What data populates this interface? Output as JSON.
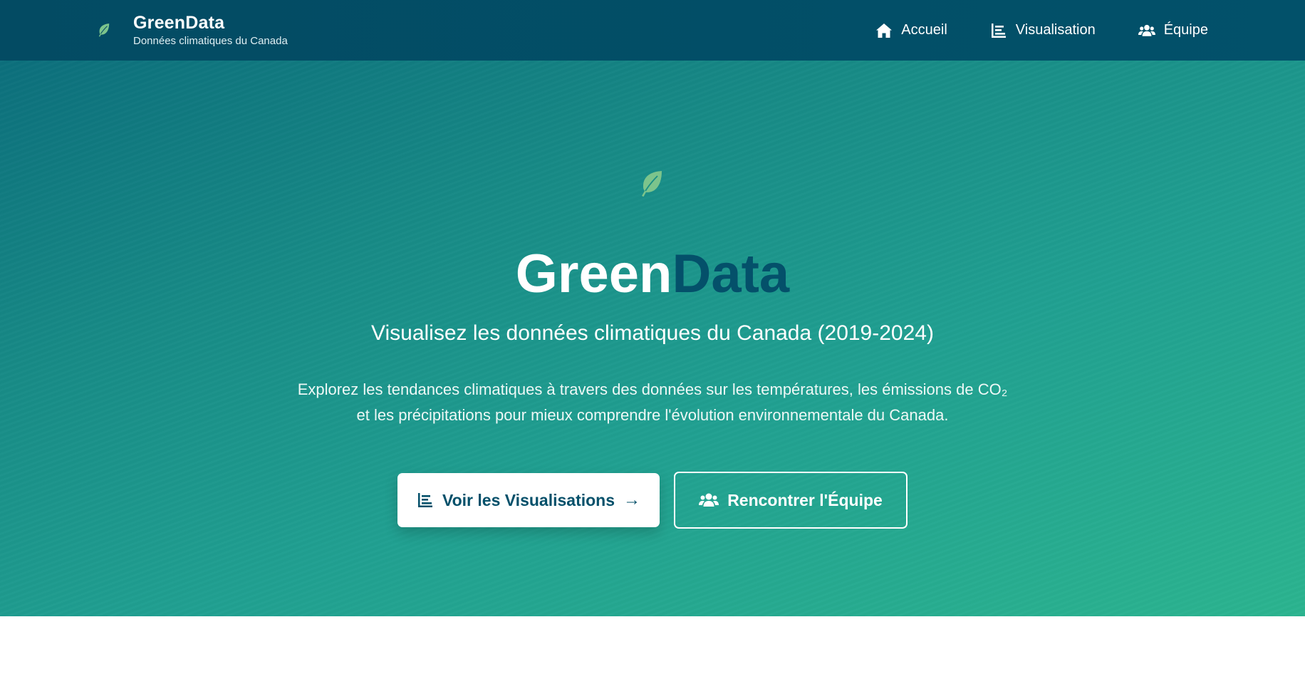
{
  "header": {
    "brand_title": "GreenData",
    "brand_subtitle": "Données climatiques du Canada",
    "nav": [
      {
        "label": "Accueil",
        "icon": "home-icon"
      },
      {
        "label": "Visualisation",
        "icon": "chart-icon"
      },
      {
        "label": "Équipe",
        "icon": "users-icon"
      }
    ]
  },
  "hero": {
    "title_part1": "Green",
    "title_part2": "Data",
    "subtitle": "Visualisez les données climatiques du Canada (2019-2024)",
    "description": "Explorez les tendances climatiques à travers des données sur les températures, les émissions de CO₂ et les précipitations pour mieux comprendre l'évolution environnementale du Canada.",
    "primary_button": "Voir les Visualisations",
    "primary_button_arrow": "→",
    "secondary_button": "Rencontrer l'Équipe"
  },
  "colors": {
    "header_bg": "#034b63",
    "accent_dark": "#04506a",
    "hero_gradient_start": "#0c6f7c",
    "hero_gradient_end": "#2bb48f",
    "leaf_green": "#7cc48c"
  }
}
